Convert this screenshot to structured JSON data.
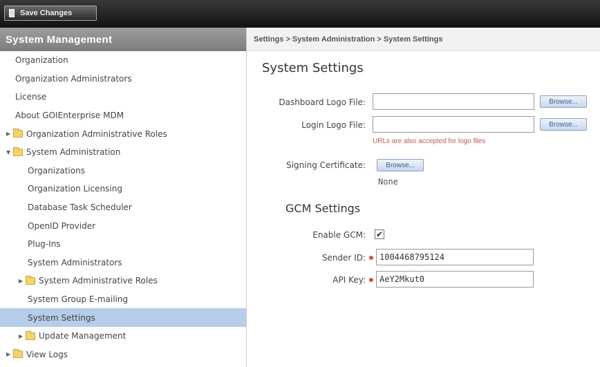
{
  "toolbar": {
    "save_label": "Save Changes"
  },
  "sidebar": {
    "title": "System Management",
    "items": [
      {
        "label": "Organization",
        "level": 0,
        "folder": false
      },
      {
        "label": "Organization Administrators",
        "level": 0,
        "folder": false
      },
      {
        "label": "License",
        "level": 0,
        "folder": false
      },
      {
        "label": "About GOIEnterprise MDM",
        "level": 0,
        "folder": false
      },
      {
        "label": "Organization Administrative Roles",
        "level": 0,
        "folder": true,
        "expanded": false
      },
      {
        "label": "System Administration",
        "level": 0,
        "folder": true,
        "expanded": true
      },
      {
        "label": "Organizations",
        "level": 1,
        "folder": false
      },
      {
        "label": "Organization Licensing",
        "level": 1,
        "folder": false
      },
      {
        "label": "Database Task Scheduler",
        "level": 1,
        "folder": false
      },
      {
        "label": "OpenID Provider",
        "level": 1,
        "folder": false
      },
      {
        "label": "Plug-Ins",
        "level": 1,
        "folder": false
      },
      {
        "label": "System Administrators",
        "level": 1,
        "folder": false
      },
      {
        "label": "System Administrative Roles",
        "level": 1,
        "folder": true,
        "expanded": false
      },
      {
        "label": "System Group E-mailing",
        "level": 1,
        "folder": false
      },
      {
        "label": "System Settings",
        "level": 1,
        "folder": false,
        "selected": true
      },
      {
        "label": "Update Management",
        "level": 1,
        "folder": true,
        "expanded": false
      },
      {
        "label": "View Logs",
        "level": 0,
        "folder": true,
        "expanded": false
      }
    ]
  },
  "breadcrumb": "Settings > System Administration > System Settings",
  "page_title": "System Settings",
  "form": {
    "dashboard_logo_label": "Dashboard Logo File:",
    "dashboard_logo_value": "",
    "login_logo_label": "Login Logo File:",
    "login_logo_value": "",
    "browse_label": "Browse...",
    "logo_hint": "URLs are also accepted for logo files",
    "signing_cert_label": "Signing Certificate:",
    "signing_cert_value": "None"
  },
  "gcm": {
    "title": "GCM Settings",
    "enable_label": "Enable GCM:",
    "enable_checked": true,
    "sender_id_label": "Sender ID:",
    "sender_id_value": "1004468795124",
    "api_key_label": "API Key:",
    "api_key_value": "AeY2Mkut0"
  },
  "colors": {
    "selected_bg": "#b5cde9",
    "required": "#e04a4a",
    "hint": "#d45a4a"
  }
}
